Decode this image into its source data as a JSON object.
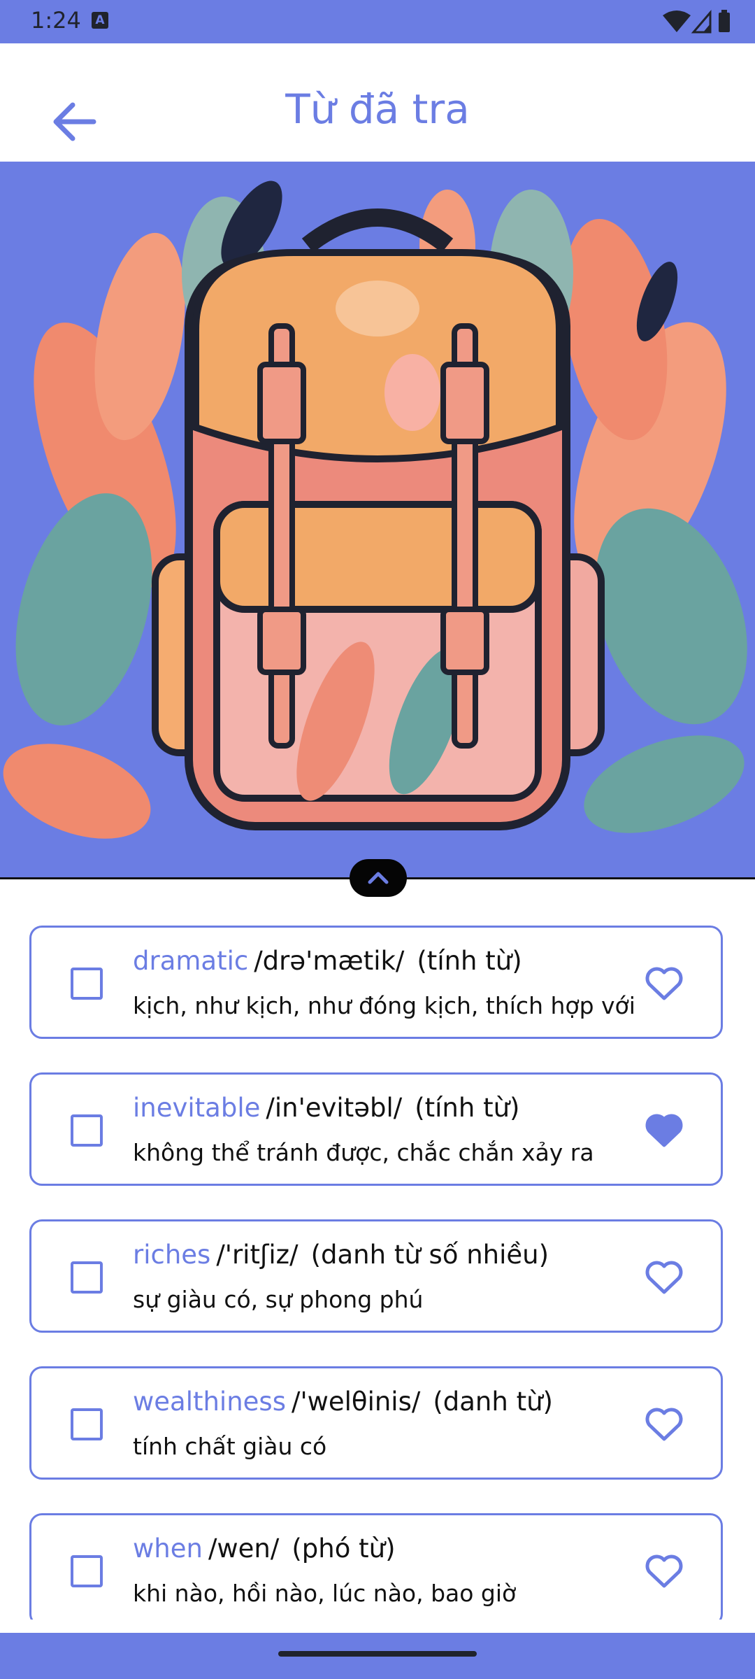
{
  "status": {
    "time": "1:24",
    "notif": "A"
  },
  "header": {
    "title": "Từ đã tra"
  },
  "colors": {
    "accent": "#6b7de3",
    "text": "#111111"
  },
  "hero": {
    "image": "backpack-illustration"
  },
  "words": [
    {
      "word": "dramatic",
      "ipa": "/drə'mætik/",
      "pos": "(tính từ)",
      "meaning": "kịch, như kịch, như đóng kịch, thích hợp với",
      "favorite": false
    },
    {
      "word": "inevitable",
      "ipa": "/in'evitəbl/",
      "pos": "(tính từ)",
      "meaning": "không thể tránh được, chắc chắn xảy ra",
      "favorite": true
    },
    {
      "word": "riches",
      "ipa": "/'ritʃiz/",
      "pos": "(danh từ số nhiều)",
      "meaning": "sự giàu có, sự phong phú",
      "favorite": false
    },
    {
      "word": "wealthiness",
      "ipa": "/'welθinis/",
      "pos": "(danh từ)",
      "meaning": "tính chất giàu có",
      "favorite": false
    },
    {
      "word": "when",
      "ipa": "/wen/",
      "pos": "(phó từ)",
      "meaning": "khi nào, hồi nào, lúc nào, bao giờ",
      "favorite": false
    }
  ]
}
